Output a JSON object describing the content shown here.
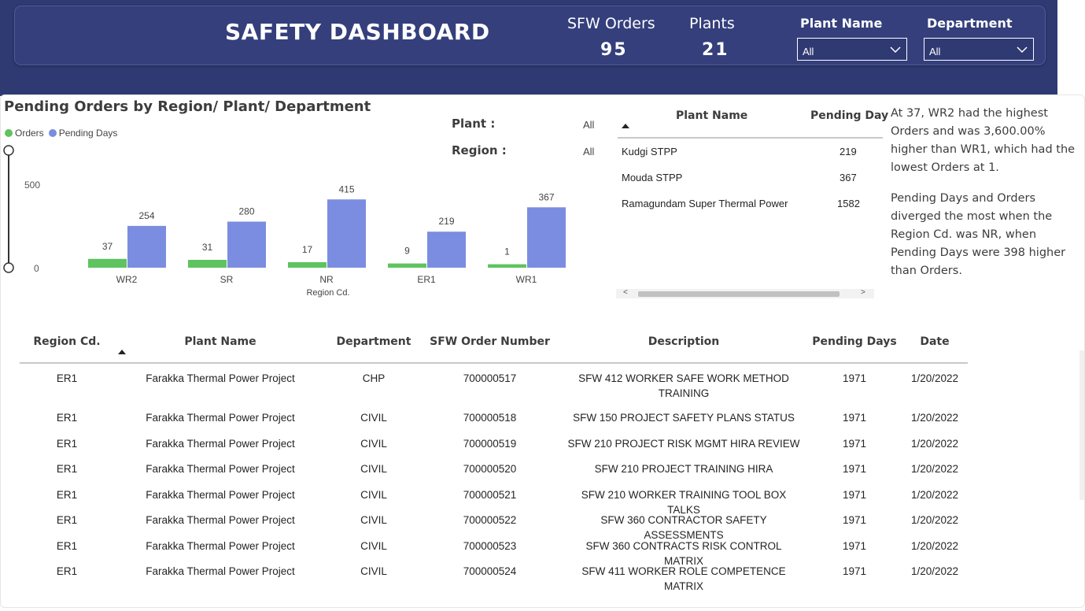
{
  "header": {
    "title": "SAFETY DASHBOARD",
    "kpis": [
      {
        "label": "SFW Orders",
        "value": "95"
      },
      {
        "label": "Plants",
        "value": "21"
      }
    ],
    "slicers": [
      {
        "label": "Plant Name",
        "value": "All"
      },
      {
        "label": "Department",
        "value": "All"
      }
    ]
  },
  "chart_panel": {
    "title": "Pending Orders by Region/ Plant/ Department",
    "legend": [
      {
        "name": "Orders",
        "color": "#5fc35f"
      },
      {
        "name": "Pending Days",
        "color": "#7b8de0"
      }
    ],
    "filters": [
      {
        "label": "Plant :",
        "value": "All"
      },
      {
        "label": "Region :",
        "value": "All"
      }
    ],
    "slider_labels": [
      "500",
      "0"
    ]
  },
  "chart_data": {
    "type": "bar",
    "title": "Pending Orders by Region/ Plant/ Department",
    "xlabel": "Region Cd.",
    "ylabel": "",
    "categories": [
      "WR2",
      "SR",
      "NR",
      "ER1",
      "WR1"
    ],
    "series": [
      {
        "name": "Orders",
        "values": [
          37,
          31,
          17,
          9,
          1
        ],
        "color": "#5fc35f"
      },
      {
        "name": "Pending Days",
        "values": [
          254,
          280,
          415,
          219,
          367
        ],
        "color": "#7b8de0"
      }
    ],
    "ylim": [
      0,
      500
    ],
    "legend_position": "top-left",
    "grid": false
  },
  "plant_table": {
    "headers": [
      "Plant Name",
      "Pending Day"
    ],
    "rows": [
      {
        "plant": "Kudgi STPP",
        "days": "219"
      },
      {
        "plant": "Mouda STPP",
        "days": "367"
      },
      {
        "plant": "Ramagundam Super Thermal Power",
        "days": "1582"
      }
    ]
  },
  "narrative": {
    "paragraphs": [
      "At 37, WR2 had the highest Orders and was 3,600.00% higher than WR1, which had the lowest Orders at 1.",
      "Pending Days and Orders diverged the most when the Region  Cd. was NR, when Pending Days were 398 higher than Orders."
    ]
  },
  "detail_table": {
    "headers": [
      "Region Cd.",
      "Plant Name",
      "Department",
      "SFW Order Number",
      "Description",
      "Pending Days",
      "Date"
    ],
    "rows": [
      [
        "ER1",
        "Farakka Thermal Power Project",
        "CHP",
        "700000517",
        "SFW 412 WORKER SAFE WORK METHOD TRAINING",
        "1971",
        "1/20/2022"
      ],
      [
        "ER1",
        "Farakka Thermal Power Project",
        "CIVIL",
        "700000518",
        "SFW 150 PROJECT SAFETY PLANS STATUS",
        "1971",
        "1/20/2022"
      ],
      [
        "ER1",
        "Farakka Thermal Power Project",
        "CIVIL",
        "700000519",
        "SFW 210 PROJECT RISK MGMT HIRA REVIEW",
        "1971",
        "1/20/2022"
      ],
      [
        "ER1",
        "Farakka Thermal Power Project",
        "CIVIL",
        "700000520",
        "SFW 210 PROJECT TRAINING HIRA",
        "1971",
        "1/20/2022"
      ],
      [
        "ER1",
        "Farakka Thermal Power Project",
        "CIVIL",
        "700000521",
        "SFW 210 WORKER TRAINING TOOL BOX TALKS",
        "1971",
        "1/20/2022"
      ],
      [
        "ER1",
        "Farakka Thermal Power Project",
        "CIVIL",
        "700000522",
        "SFW 360 CONTRACTOR SAFETY ASSESSMENTS",
        "1971",
        "1/20/2022"
      ],
      [
        "ER1",
        "Farakka Thermal Power Project",
        "CIVIL",
        "700000523",
        "SFW 360 CONTRACTS RISK CONTROL MATRIX",
        "1971",
        "1/20/2022"
      ],
      [
        "ER1",
        "Farakka Thermal Power Project",
        "CIVIL",
        "700000524",
        "SFW 411 WORKER ROLE COMPETENCE MATRIX",
        "1971",
        "1/20/2022"
      ]
    ]
  }
}
